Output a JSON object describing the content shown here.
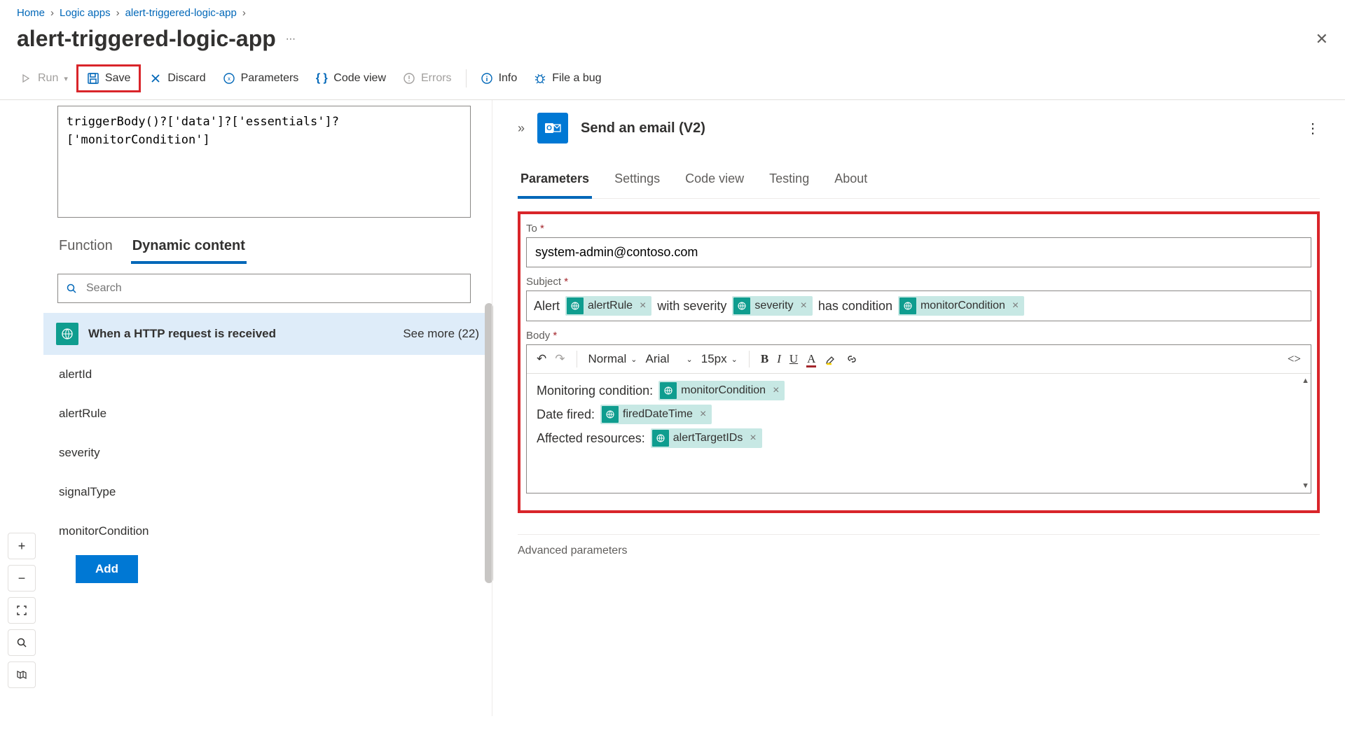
{
  "breadcrumb": {
    "home": "Home",
    "logicapps": "Logic apps",
    "appname": "alert-triggered-logic-app"
  },
  "title": "alert-triggered-logic-app",
  "toolbar": {
    "run": "Run",
    "save": "Save",
    "discard": "Discard",
    "parameters": "Parameters",
    "codeview": "Code view",
    "errors": "Errors",
    "info": "Info",
    "bug": "File a bug"
  },
  "expression": "triggerBody()?['data']?['essentials']?['monitorCondition']",
  "subtabs": {
    "function": "Function",
    "dynamic": "Dynamic content"
  },
  "search_placeholder": "Search",
  "dc": {
    "header": "When a HTTP request is received",
    "seemore": "See more (22)",
    "items": [
      "alertId",
      "alertRule",
      "severity",
      "signalType",
      "monitorCondition"
    ],
    "add": "Add"
  },
  "right": {
    "title": "Send an email (V2)",
    "tabs": [
      "Parameters",
      "Settings",
      "Code view",
      "Testing",
      "About"
    ],
    "to_label": "To",
    "to_value": "system-admin@contoso.com",
    "subject_label": "Subject",
    "subject_parts": {
      "t1": "Alert",
      "tok1": "alertRule",
      "t2": "with severity",
      "tok2": "severity",
      "t3": "has condition",
      "tok3": "monitorCondition"
    },
    "body_label": "Body",
    "body_toolbar": {
      "normal": "Normal",
      "font": "Arial",
      "size": "15px"
    },
    "body_lines": {
      "l1": "Monitoring condition:",
      "tok1": "monitorCondition",
      "l2": "Date fired:",
      "tok2": "firedDateTime",
      "l3": "Affected resources:",
      "tok3": "alertTargetIDs"
    },
    "advanced": "Advanced parameters"
  }
}
